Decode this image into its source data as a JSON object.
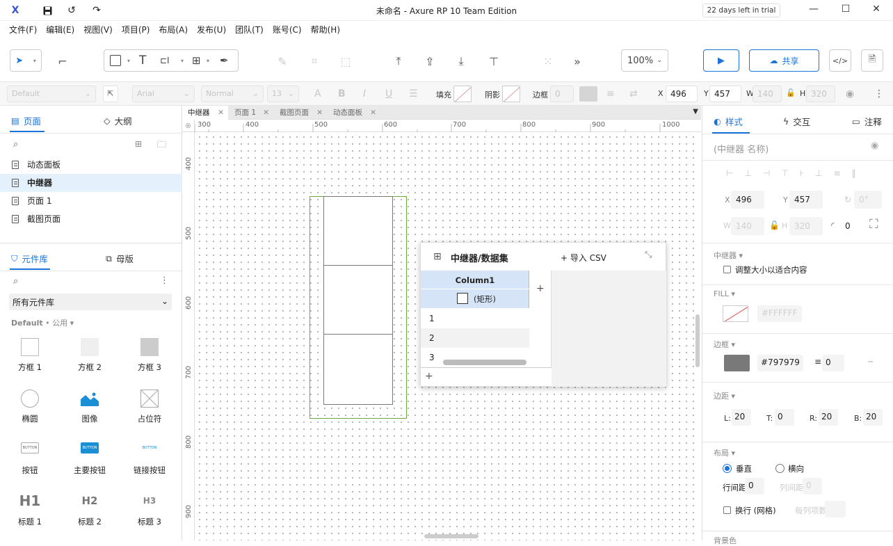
{
  "titlebar": {
    "logo": "X",
    "title": "未命名 - Axure RP 10 Team Edition",
    "trial": "22 days left in trial"
  },
  "menu": [
    "文件(F)",
    "编辑(E)",
    "视图(V)",
    "项目(P)",
    "布局(A)",
    "发布(U)",
    "团队(T)",
    "账号(C)",
    "帮助(H)"
  ],
  "toolbar": {
    "zoom": "100%",
    "share_label": "共享",
    "more": "»"
  },
  "format": {
    "style_select": "Default",
    "font_select": "Arial",
    "weight_select": "Normal",
    "size_select": "13",
    "fill_label": "填充",
    "shadow_label": "阴影",
    "border_label": "边框",
    "border_width": "0",
    "x_label": "X",
    "x_value": "496",
    "y_label": "Y",
    "y_value": "457",
    "w_label": "W",
    "w_value": "140",
    "h_label": "H",
    "h_value": "320"
  },
  "left": {
    "pages_tab": "页面",
    "outline_tab": "大纲",
    "pages": [
      "动态面板",
      "中继器",
      "页面 1",
      "截图页面"
    ],
    "selected_page": 1,
    "library_tab": "元件库",
    "masters_tab": "母版",
    "library_select": "所有元件库",
    "library_group": "Default",
    "library_group_sub": "公用",
    "items": [
      "方框 1",
      "方框 2",
      "方框 3",
      "椭圆",
      "图像",
      "占位符",
      "按钮",
      "主要按钮",
      "链接按钮",
      "标题 1",
      "标题 2",
      "标题 3"
    ],
    "button_thumb_text": "BUTTON",
    "h1": "H1",
    "h2": "H2",
    "h3": "H3"
  },
  "tabs": [
    "中继器",
    "页面 1",
    "截图页面",
    "动态面板"
  ],
  "ruler": {
    "h": [
      "300",
      "400",
      "500",
      "600",
      "700",
      "800",
      "900",
      "1000"
    ],
    "v": [
      "400",
      "500",
      "600",
      "700",
      "800",
      "900"
    ]
  },
  "dataset": {
    "title": "中继器/数据集",
    "import_csv": "导入 CSV",
    "column": "Column1",
    "type_label": "(矩形)",
    "rows": [
      "1",
      "2",
      "3"
    ],
    "add": "+"
  },
  "right": {
    "tab_style": "样式",
    "tab_interact": "交互",
    "tab_notes": "注释",
    "name_placeholder": "(中继器 名称)",
    "x_label": "X",
    "x": "496",
    "y_label": "Y",
    "y": "457",
    "rot": "0°",
    "w_label": "W",
    "w": "140",
    "h_label": "H",
    "h": "320",
    "radius": "0",
    "repeater_section": "中继器",
    "fit_content": "调整大小以适合内容",
    "fill_section": "FILL",
    "fill_color": "#FFFFFF",
    "border_section": "边框",
    "border_color": "#797979",
    "border_width": "0",
    "padding_section": "边距",
    "pad_l_label": "L:",
    "pad_l": "20",
    "pad_t_label": "T:",
    "pad_t": "0",
    "pad_r_label": "R:",
    "pad_r": "20",
    "pad_b_label": "B:",
    "pad_b": "20",
    "layout_section": "布局",
    "vertical": "垂直",
    "horizontal": "横向",
    "row_gap_label": "行间距",
    "row_gap": "0",
    "col_gap_label": "列间距",
    "col_gap": "0",
    "wrap_label": "换行 (网格)",
    "per_row_label": "每列项数",
    "bg_section": "背景色"
  },
  "colors": {
    "accent": "#1a73d9",
    "selection": "#6aaa3c",
    "header_blue": "#d6e4f7",
    "border_swatch": "#797979"
  }
}
